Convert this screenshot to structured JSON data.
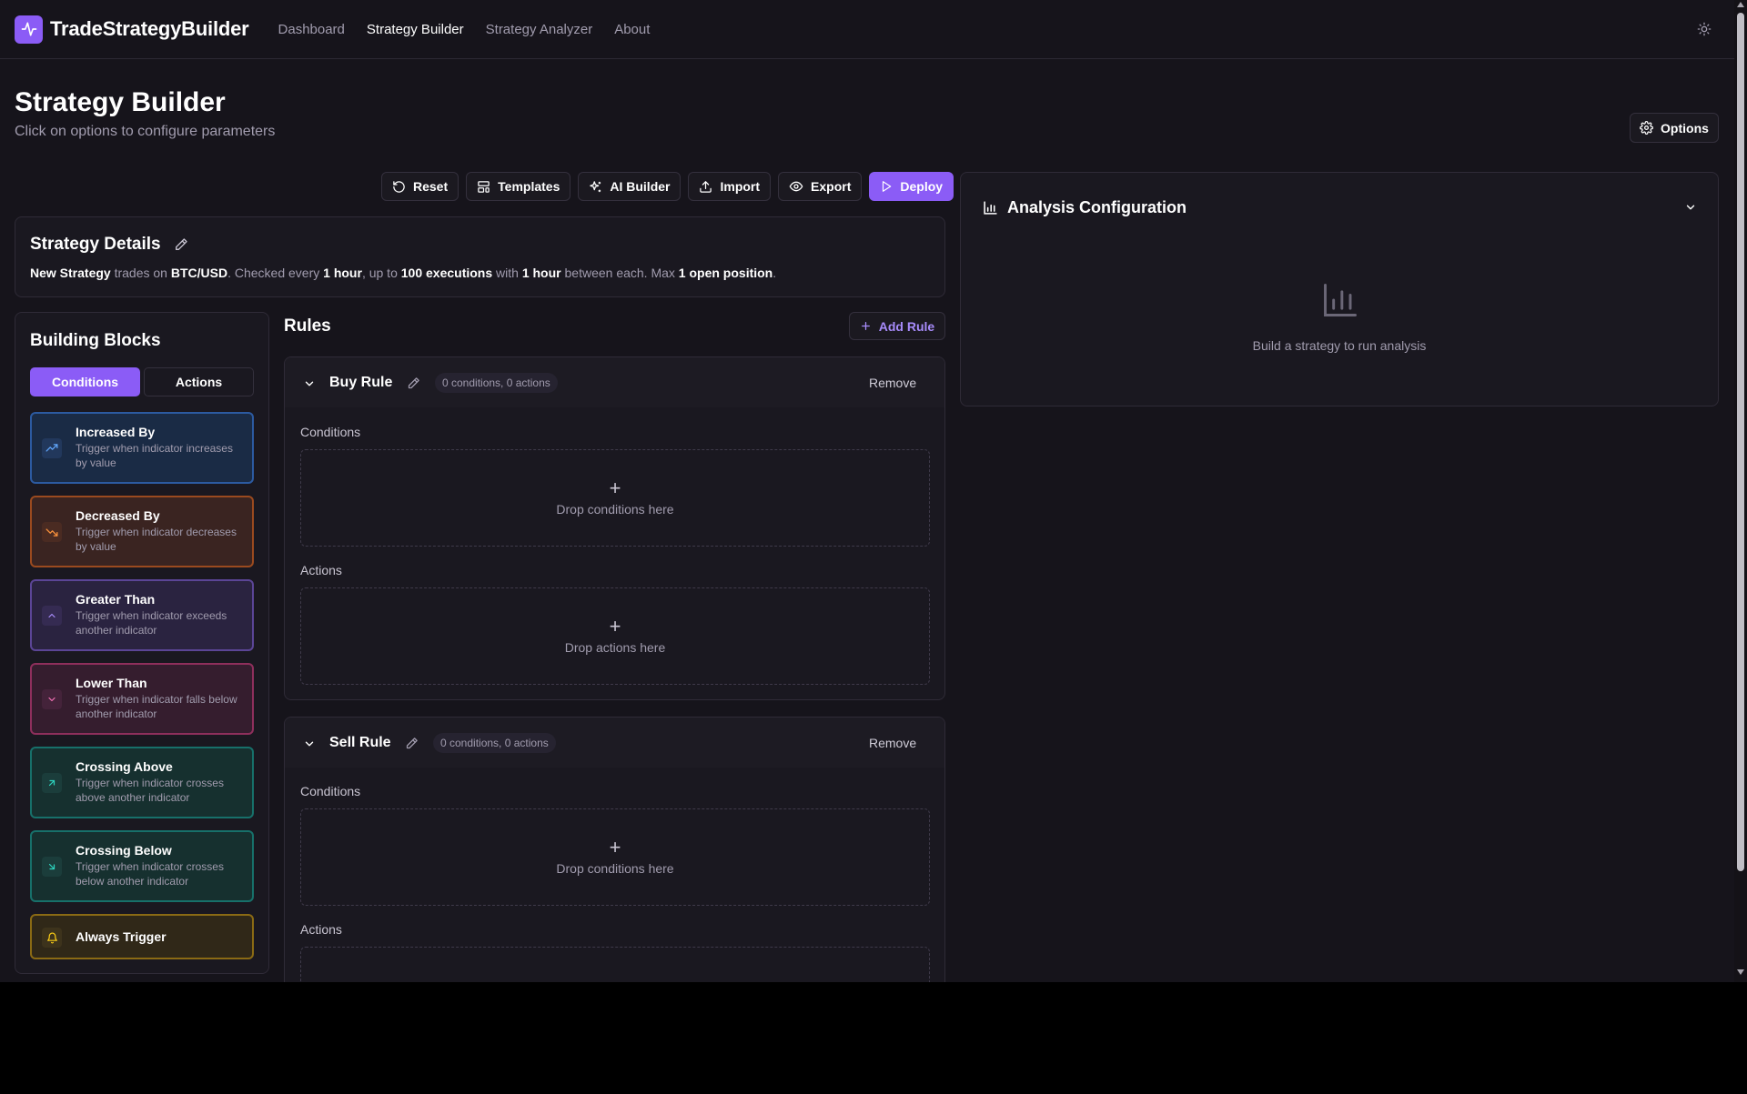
{
  "nav": {
    "brand": "TradeStrategyBuilder",
    "links": [
      "Dashboard",
      "Strategy Builder",
      "Strategy Analyzer",
      "About"
    ]
  },
  "header": {
    "title": "Strategy Builder",
    "subtitle": "Click on options to configure parameters",
    "options_label": "Options"
  },
  "toolbar": {
    "reset": "Reset",
    "templates": "Templates",
    "ai_builder": "AI Builder",
    "import": "Import",
    "export": "Export",
    "deploy": "Deploy"
  },
  "details": {
    "title": "Strategy Details",
    "name": "New Strategy",
    "t1": "trades on",
    "pair": "BTC/USD",
    "t2": ". Checked every",
    "interval": "1 hour",
    "t3": ", up to",
    "executions": "100 executions",
    "t4": "with",
    "cooldown": "1 hour",
    "t5": "between each. Max",
    "positions": "1 open position",
    "t6": "."
  },
  "blocks": {
    "title": "Building Blocks",
    "tab_conditions": "Conditions",
    "tab_actions": "Actions",
    "items": [
      {
        "name": "Increased By",
        "desc": "Trigger when indicator increases by value"
      },
      {
        "name": "Decreased By",
        "desc": "Trigger when indicator decreases by value"
      },
      {
        "name": "Greater Than",
        "desc": "Trigger when indicator exceeds another indicator"
      },
      {
        "name": "Lower Than",
        "desc": "Trigger when indicator falls below another indicator"
      },
      {
        "name": "Crossing Above",
        "desc": "Trigger when indicator crosses above another indicator"
      },
      {
        "name": "Crossing Below",
        "desc": "Trigger when indicator crosses below another indicator"
      },
      {
        "name": "Always Trigger",
        "desc": ""
      }
    ],
    "colors": {
      "increased": "#3b82f6",
      "decreased": "#f97316",
      "greater": "#8b5cf6",
      "lower": "#ec4899",
      "crossing_above": "#14b8a6",
      "crossing_below": "#14b8a6",
      "always": "#eab308"
    }
  },
  "rules": {
    "title": "Rules",
    "add_label": "Add Rule",
    "items": [
      {
        "name": "Buy Rule",
        "badge": "0 conditions, 0 actions",
        "remove": "Remove",
        "conditions_label": "Conditions",
        "conditions_drop": "Drop conditions here",
        "actions_label": "Actions",
        "actions_drop": "Drop actions here"
      },
      {
        "name": "Sell Rule",
        "badge": "0 conditions, 0 actions",
        "remove": "Remove",
        "conditions_label": "Conditions",
        "conditions_drop": "Drop conditions here",
        "actions_label": "Actions"
      }
    ]
  },
  "analysis": {
    "title": "Analysis Configuration",
    "empty_text": "Build a strategy to run analysis"
  },
  "theme": {
    "accent": "#8b5cf6",
    "background": "#16141b"
  }
}
